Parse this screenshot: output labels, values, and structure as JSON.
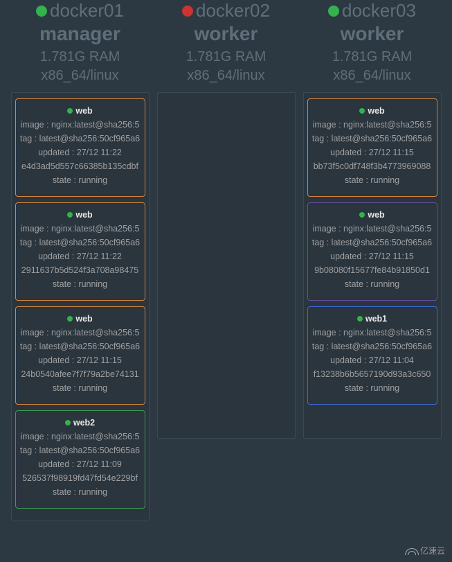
{
  "watermark": "亿速云",
  "nodes": [
    {
      "name": "docker01",
      "status": "green",
      "role": "manager",
      "ram": "1.781G RAM",
      "arch": "x86_64/linux",
      "tasks": [
        {
          "color": "orange",
          "name": "web",
          "image": "image : nginx:latest@sha256:5",
          "tag": "tag : latest@sha256:50cf965a6",
          "updated": "updated : 27/12 11:22",
          "hash": "e4d3ad5d557c66385b135cdbf",
          "state": "state : running"
        },
        {
          "color": "orange",
          "name": "web",
          "image": "image : nginx:latest@sha256:5",
          "tag": "tag : latest@sha256:50cf965a6",
          "updated": "updated : 27/12 11:22",
          "hash": "2911637b5d524f3a708a98475",
          "state": "state : running"
        },
        {
          "color": "orange",
          "name": "web",
          "image": "image : nginx:latest@sha256:5",
          "tag": "tag : latest@sha256:50cf965a6",
          "updated": "updated : 27/12 11:15",
          "hash": "24b0540afee7f7f79a2be74131",
          "state": "state : running"
        },
        {
          "color": "green2",
          "name": "web2",
          "image": "image : nginx:latest@sha256:5",
          "tag": "tag : latest@sha256:50cf965a6",
          "updated": "updated : 27/12 11:09",
          "hash": "526537f98919fd47fd54e229bf",
          "state": "state : running"
        }
      ]
    },
    {
      "name": "docker02",
      "status": "red",
      "role": "worker",
      "ram": "1.781G RAM",
      "arch": "x86_64/linux",
      "tasks": []
    },
    {
      "name": "docker03",
      "status": "green",
      "role": "worker",
      "ram": "1.781G RAM",
      "arch": "x86_64/linux",
      "tasks": [
        {
          "color": "orange",
          "name": "web",
          "image": "image : nginx:latest@sha256:5",
          "tag": "tag : latest@sha256:50cf965a6",
          "updated": "updated : 27/12 11:15",
          "hash": "bb73f5c0df748f3b4773969088",
          "state": "state : running"
        },
        {
          "color": "purple",
          "name": "web",
          "image": "image : nginx:latest@sha256:5",
          "tag": "tag : latest@sha256:50cf965a6",
          "updated": "updated : 27/12 11:15",
          "hash": "9b08080f15677fe84b91850d1",
          "state": "state : running"
        },
        {
          "color": "blue",
          "name": "web1",
          "image": "image : nginx:latest@sha256:5",
          "tag": "tag : latest@sha256:50cf965a6",
          "updated": "updated : 27/12 11:04",
          "hash": "f13238b6b5657190d93a3c650",
          "state": "state : running"
        }
      ]
    }
  ]
}
